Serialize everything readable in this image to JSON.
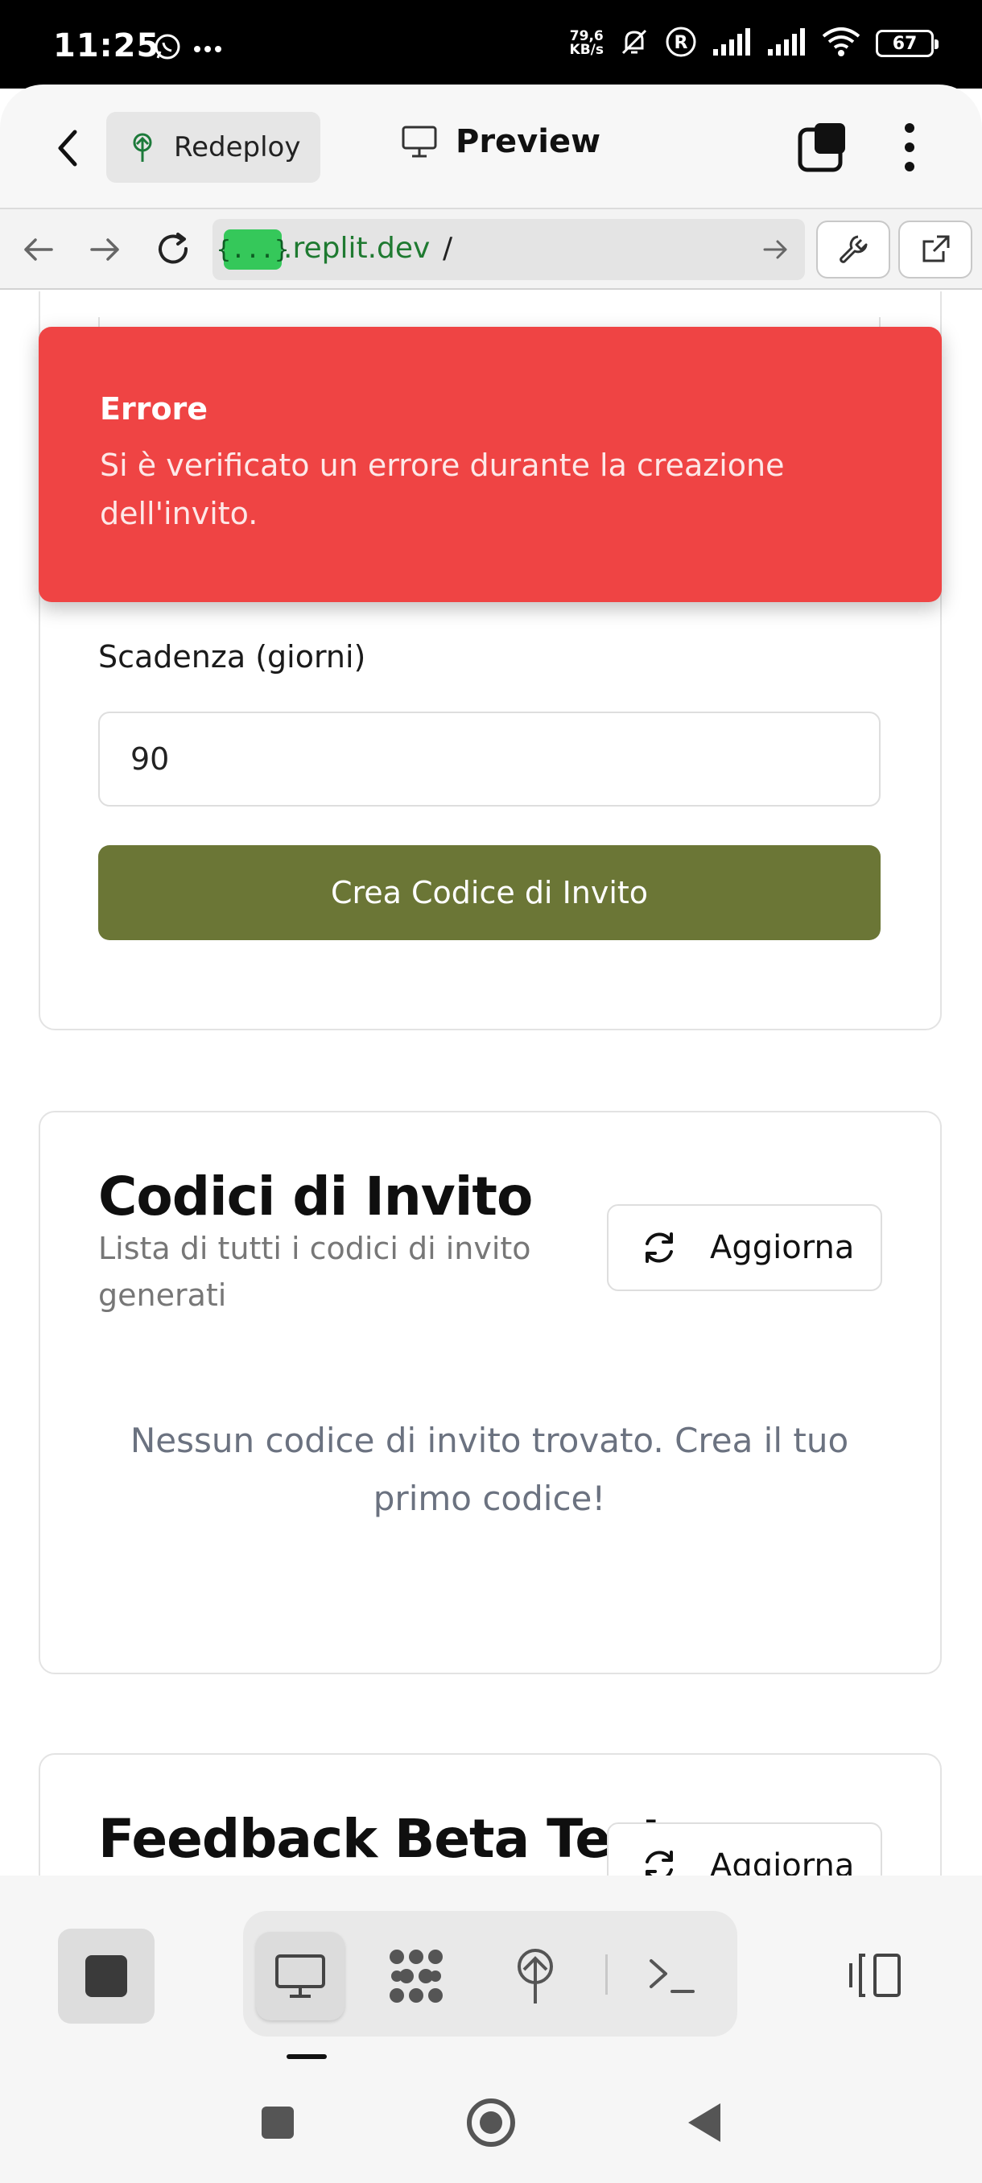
{
  "status_bar": {
    "time": "11:25",
    "net_speed_value": "79,6",
    "net_speed_unit": "KB/s",
    "battery": "67",
    "icons": [
      "whatsapp-icon",
      "more-dots-icon",
      "mute-bell-icon",
      "registered-icon",
      "signal-icon",
      "signal-icon",
      "wifi-icon",
      "battery-icon"
    ]
  },
  "header": {
    "redeploy_label": "Redeploy",
    "preview_label": "Preview"
  },
  "url_bar": {
    "highlight": "{...}",
    "host": ".replit.dev",
    "path": "/"
  },
  "form": {
    "expiry_label": "Scadenza (giorni)",
    "expiry_value": "90",
    "create_button": "Crea Codice di Invito"
  },
  "toast": {
    "title": "Errore",
    "message": "Si è verificato un errore durante la creazione dell'invito."
  },
  "invites_card": {
    "title": "Codici di Invito",
    "subtitle": "Lista di tutti i codici di invito generati",
    "refresh_label": "Aggiorna",
    "empty_message": "Nessun codice di invito trovato. Crea il tuo primo codice!"
  },
  "feedback_card": {
    "title": "Feedback Beta Test",
    "refresh_label": "Aggiorna"
  },
  "colors": {
    "primary_button": "#6b7636",
    "toast_error": "#ef4444",
    "url_highlight": "#35c85a"
  }
}
